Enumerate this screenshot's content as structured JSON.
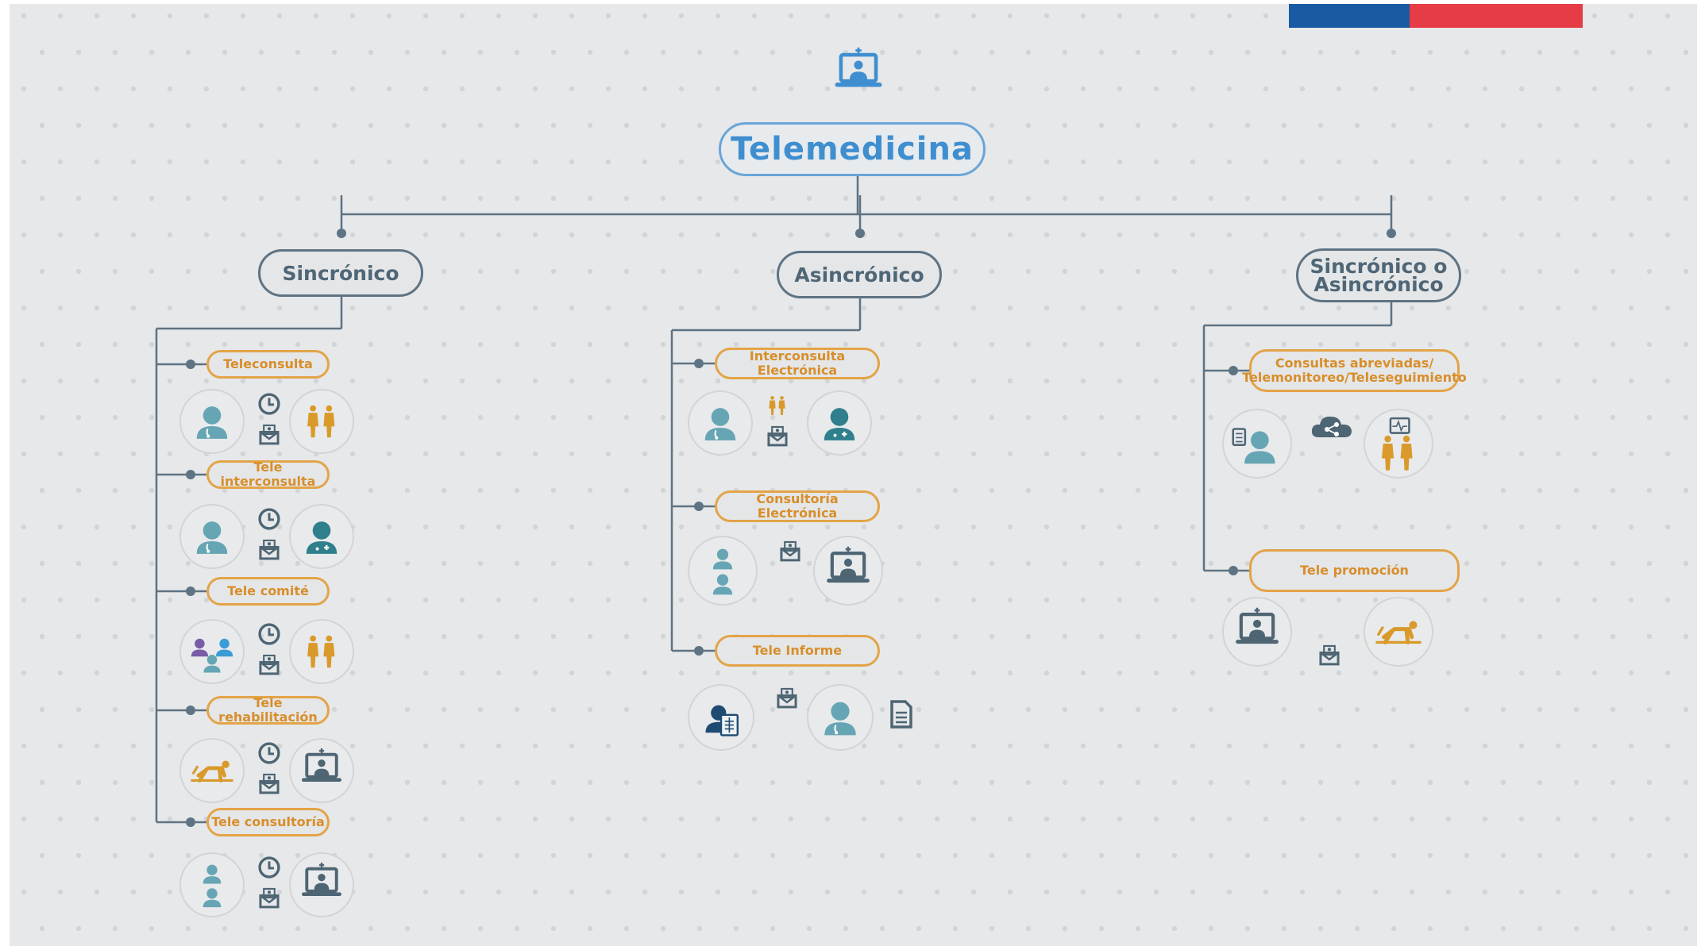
{
  "colors": {
    "background": "#e6e8ea",
    "outer_background": "#ffffff",
    "flag_blue": "#1a5aa2",
    "flag_red": "#e63c46",
    "connector": "#5e7383",
    "root_accent": "#3f8fd0",
    "category_accent": "#4f6676",
    "sub_accent": "#d88e2a",
    "doctor_teal": "#66a5b3",
    "doctor_dark_teal": "#2f7f8c",
    "patient_orange": "#d99a2b",
    "device_slate": "#4e6573",
    "specialist_purple": "#7a5ba6",
    "specialist_blue": "#3b9bd6"
  },
  "root": {
    "label": "Telemedicina",
    "icon": "doctor-laptop-icon"
  },
  "categories": [
    {
      "label": "Sincrónico",
      "items": [
        {
          "label": "Teleconsulta",
          "icons": [
            "doctor-icon",
            "clock-icon",
            "mail-icon",
            "patients-icon"
          ]
        },
        {
          "label": "Tele interconsulta",
          "icons": [
            "doctor-icon",
            "clock-icon",
            "mail-icon",
            "specialist-icon"
          ]
        },
        {
          "label": "Tele comité",
          "icons": [
            "doctor-group-icon",
            "clock-icon",
            "mail-icon",
            "patients-icon"
          ]
        },
        {
          "label": "Tele rehabilitación",
          "icons": [
            "rehab-exercise-icon",
            "clock-icon",
            "mail-icon",
            "laptop-doctor-icon"
          ]
        },
        {
          "label": "Tele consultoría",
          "icons": [
            "two-doctors-icon",
            "clock-icon",
            "mail-icon",
            "laptop-doctor-icon"
          ]
        }
      ]
    },
    {
      "label": "Asincrónico",
      "items": [
        {
          "label": "Interconsulta Electrónica",
          "icons": [
            "doctor-icon",
            "patients-icon",
            "mail-icon",
            "specialist-icon"
          ]
        },
        {
          "label": "Consultoría Electrónica",
          "icons": [
            "two-doctors-icon",
            "mail-icon",
            "laptop-doctor-icon"
          ]
        },
        {
          "label": "Tele Informe",
          "icons": [
            "xray-patient-icon",
            "mail-icon",
            "doctor-icon",
            "document-icon"
          ]
        }
      ]
    },
    {
      "label": "Sincrónico o\nAsincrónico",
      "items": [
        {
          "label": "Consultas abreviadas/\nTelemonitoreo/Teleseguimiento",
          "icons": [
            "doctor-clipboard-icon",
            "cloud-share-icon",
            "monitoring-patients-icon"
          ]
        },
        {
          "label": "Tele promoción",
          "icons": [
            "laptop-doctor-icon",
            "mail-icon",
            "rehab-exercise-icon"
          ]
        }
      ]
    }
  ]
}
